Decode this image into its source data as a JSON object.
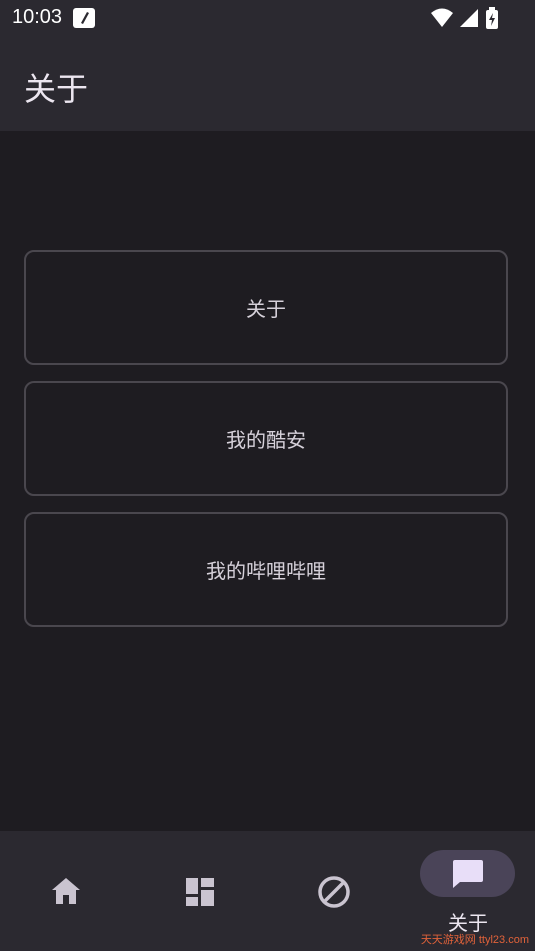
{
  "status": {
    "time": "10:03"
  },
  "appbar": {
    "title": "关于"
  },
  "cards": [
    {
      "label": "关于"
    },
    {
      "label": "我的酷安"
    },
    {
      "label": "我的哔哩哔哩"
    }
  ],
  "nav": {
    "items": [
      {
        "icon": "home-icon"
      },
      {
        "icon": "dashboard-icon"
      },
      {
        "icon": "block-icon"
      },
      {
        "icon": "chat-icon",
        "label": "关于",
        "active": true
      }
    ]
  },
  "watermark": {
    "text": "天天游戏网 ttyl23.com"
  },
  "colors": {
    "background": "#1e1c21",
    "bars": "#2b2930",
    "active_pill": "#4a4458",
    "card_border": "#4a474e"
  }
}
